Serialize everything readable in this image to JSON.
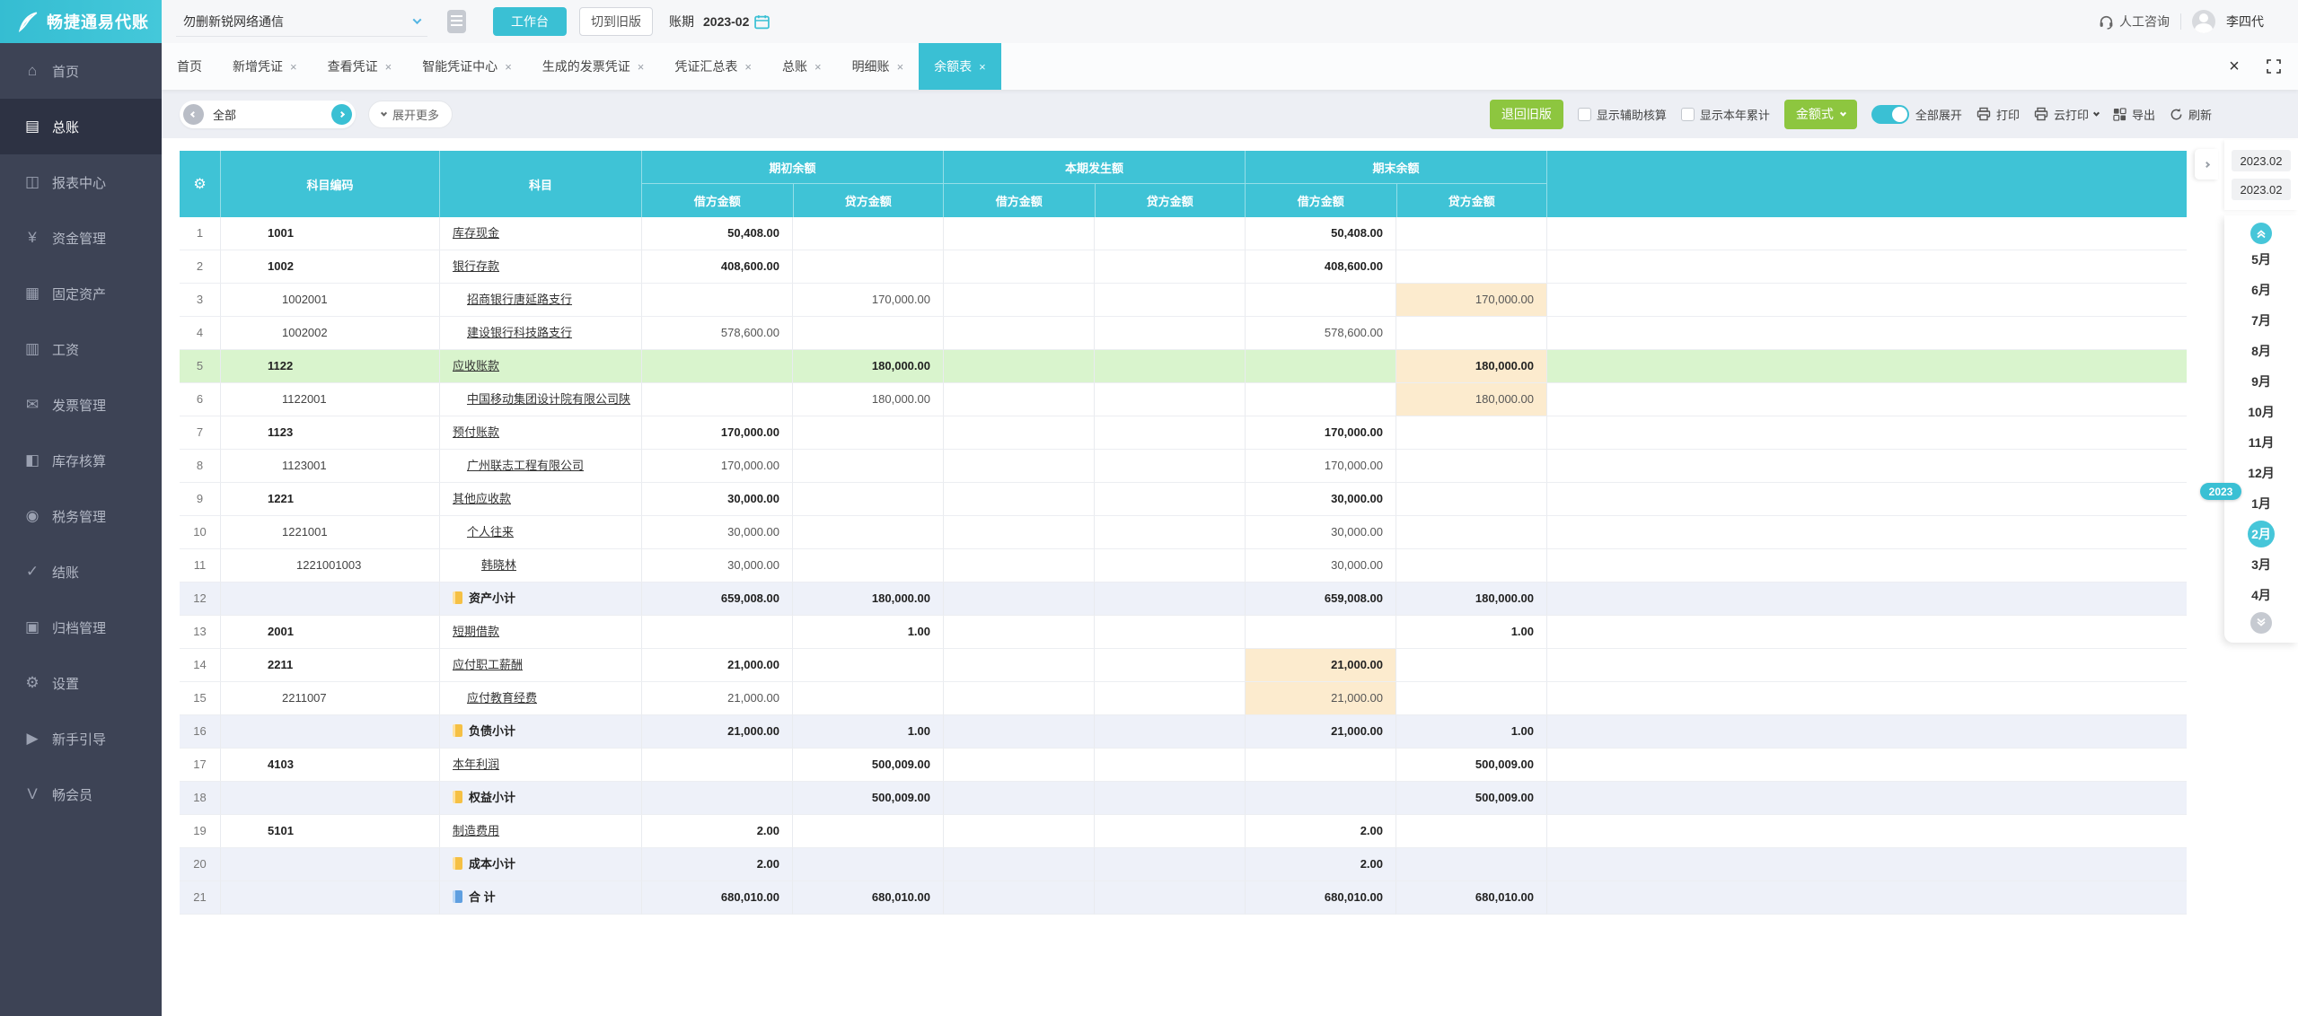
{
  "app": {
    "logo_text": "畅捷通易代账",
    "company": "勿删新锐网络通信",
    "workbench_button": "工作台",
    "switch_old_button": "切到旧版",
    "period_label": "账期",
    "period_value": "2023-02",
    "support_label": "人工咨询",
    "user_name": "李四代"
  },
  "sidebar": {
    "items": [
      {
        "label": "首页",
        "icon": "home-icon",
        "active": false
      },
      {
        "label": "总账",
        "icon": "ledger-icon",
        "active": true
      },
      {
        "label": "报表中心",
        "icon": "report-icon",
        "active": false
      },
      {
        "label": "资金管理",
        "icon": "funds-icon",
        "active": false
      },
      {
        "label": "固定资产",
        "icon": "fixed-asset-icon",
        "active": false
      },
      {
        "label": "工资",
        "icon": "salary-icon",
        "active": false
      },
      {
        "label": "发票管理",
        "icon": "invoice-icon",
        "active": false
      },
      {
        "label": "库存核算",
        "icon": "inventory-icon",
        "active": false
      },
      {
        "label": "税务管理",
        "icon": "tax-icon",
        "active": false
      },
      {
        "label": "结账",
        "icon": "closing-icon",
        "active": false
      },
      {
        "label": "归档管理",
        "icon": "archive-icon",
        "active": false
      },
      {
        "label": "设置",
        "icon": "settings-icon",
        "active": false
      },
      {
        "label": "新手引导",
        "icon": "guide-icon",
        "active": false
      },
      {
        "label": "畅会员",
        "icon": "member-icon",
        "active": false
      }
    ]
  },
  "tabs": {
    "items": [
      {
        "label": "首页",
        "closable": false,
        "active": false
      },
      {
        "label": "新增凭证",
        "closable": true,
        "active": false
      },
      {
        "label": "查看凭证",
        "closable": true,
        "active": false
      },
      {
        "label": "智能凭证中心",
        "closable": true,
        "active": false
      },
      {
        "label": "生成的发票凭证",
        "closable": true,
        "active": false
      },
      {
        "label": "凭证汇总表",
        "closable": true,
        "active": false
      },
      {
        "label": "总账",
        "closable": true,
        "active": false
      },
      {
        "label": "明细账",
        "closable": true,
        "active": false
      },
      {
        "label": "余额表",
        "closable": true,
        "active": true
      }
    ]
  },
  "toolbar": {
    "scope_value": "全部",
    "expand_more_label": "展开更多",
    "back_old_version_label": "退回旧版",
    "checkbox_aux_label": "显示辅助核算",
    "checkbox_ytd_label": "显示本年累计",
    "amount_style_label": "金额式",
    "expand_all_label": "全部展开",
    "print_label": "打印",
    "cloud_print_label": "云打印",
    "export_label": "导出",
    "refresh_label": "刷新"
  },
  "table": {
    "headers": {
      "code": "科目编码",
      "subject": "科目",
      "debit": "借方金额",
      "credit": "贷方金额",
      "groups": [
        {
          "label": "期初余额"
        },
        {
          "label": "本期发生额"
        },
        {
          "label": "期末余额"
        }
      ]
    },
    "rows": [
      {
        "num": 1,
        "code": "1001",
        "name": "库存现金",
        "level": 0,
        "bold": true,
        "expand": false,
        "underline": true,
        "icon": "",
        "bg": "",
        "hl": [],
        "od": "50,408.00",
        "oc": "",
        "cd": "",
        "cc": "",
        "ed": "50,408.00",
        "ec": ""
      },
      {
        "num": 2,
        "code": "1002",
        "name": "银行存款",
        "level": 0,
        "bold": true,
        "expand": true,
        "underline": true,
        "icon": "",
        "bg": "",
        "hl": [],
        "od": "408,600.00",
        "oc": "",
        "cd": "",
        "cc": "",
        "ed": "408,600.00",
        "ec": ""
      },
      {
        "num": 3,
        "code": "1002001",
        "name": "招商银行唐延路支行",
        "level": 1,
        "bold": false,
        "expand": false,
        "underline": true,
        "icon": "",
        "bg": "",
        "hl": [
          "ec"
        ],
        "od": "",
        "oc": "170,000.00",
        "cd": "",
        "cc": "",
        "ed": "",
        "ec": "170,000.00"
      },
      {
        "num": 4,
        "code": "1002002",
        "name": "建设银行科技路支行",
        "level": 1,
        "bold": false,
        "expand": false,
        "underline": true,
        "icon": "",
        "bg": "",
        "hl": [],
        "od": "578,600.00",
        "oc": "",
        "cd": "",
        "cc": "",
        "ed": "578,600.00",
        "ec": ""
      },
      {
        "num": 5,
        "code": "1122",
        "name": "应收账款",
        "level": 0,
        "bold": true,
        "expand": true,
        "underline": true,
        "icon": "",
        "bg": "green",
        "hl": [
          "ec"
        ],
        "od": "",
        "oc": "180,000.00",
        "cd": "",
        "cc": "",
        "ed": "",
        "ec": "180,000.00"
      },
      {
        "num": 6,
        "code": "1122001",
        "name": "中国移动集团设计院有限公司陕",
        "level": 1,
        "bold": false,
        "expand": false,
        "underline": true,
        "icon": "",
        "bg": "",
        "hl": [
          "ec"
        ],
        "od": "",
        "oc": "180,000.00",
        "cd": "",
        "cc": "",
        "ed": "",
        "ec": "180,000.00"
      },
      {
        "num": 7,
        "code": "1123",
        "name": "预付账款",
        "level": 0,
        "bold": true,
        "expand": true,
        "underline": true,
        "icon": "",
        "bg": "",
        "hl": [],
        "od": "170,000.00",
        "oc": "",
        "cd": "",
        "cc": "",
        "ed": "170,000.00",
        "ec": ""
      },
      {
        "num": 8,
        "code": "1123001",
        "name": "广州联志工程有限公司",
        "level": 1,
        "bold": false,
        "expand": false,
        "underline": true,
        "icon": "",
        "bg": "",
        "hl": [],
        "od": "170,000.00",
        "oc": "",
        "cd": "",
        "cc": "",
        "ed": "170,000.00",
        "ec": ""
      },
      {
        "num": 9,
        "code": "1221",
        "name": "其他应收款",
        "level": 0,
        "bold": true,
        "expand": true,
        "underline": true,
        "icon": "",
        "bg": "",
        "hl": [],
        "od": "30,000.00",
        "oc": "",
        "cd": "",
        "cc": "",
        "ed": "30,000.00",
        "ec": ""
      },
      {
        "num": 10,
        "code": "1221001",
        "name": "个人往来",
        "level": 1,
        "bold": false,
        "expand": true,
        "underline": true,
        "icon": "",
        "bg": "",
        "hl": [],
        "od": "30,000.00",
        "oc": "",
        "cd": "",
        "cc": "",
        "ed": "30,000.00",
        "ec": ""
      },
      {
        "num": 11,
        "code": "1221001003",
        "name": "韩晓林",
        "level": 2,
        "bold": false,
        "expand": false,
        "underline": true,
        "icon": "",
        "bg": "",
        "hl": [],
        "od": "30,000.00",
        "oc": "",
        "cd": "",
        "cc": "",
        "ed": "30,000.00",
        "ec": ""
      },
      {
        "num": 12,
        "code": "",
        "name": "资产小计",
        "level": 0,
        "bold": true,
        "expand": false,
        "underline": false,
        "icon": "yellow",
        "bg": "lav",
        "hl": [],
        "od": "659,008.00",
        "oc": "180,000.00",
        "cd": "",
        "cc": "",
        "ed": "659,008.00",
        "ec": "180,000.00"
      },
      {
        "num": 13,
        "code": "2001",
        "name": "短期借款",
        "level": 0,
        "bold": true,
        "expand": false,
        "underline": true,
        "icon": "",
        "bg": "",
        "hl": [],
        "od": "",
        "oc": "1.00",
        "cd": "",
        "cc": "",
        "ed": "",
        "ec": "1.00"
      },
      {
        "num": 14,
        "code": "2211",
        "name": "应付职工薪酬",
        "level": 0,
        "bold": true,
        "expand": true,
        "underline": true,
        "icon": "",
        "bg": "",
        "hl": [
          "ed"
        ],
        "od": "21,000.00",
        "oc": "",
        "cd": "",
        "cc": "",
        "ed": "21,000.00",
        "ec": ""
      },
      {
        "num": 15,
        "code": "2211007",
        "name": "应付教育经费",
        "level": 1,
        "bold": false,
        "expand": false,
        "underline": true,
        "icon": "",
        "bg": "",
        "hl": [
          "ed"
        ],
        "od": "21,000.00",
        "oc": "",
        "cd": "",
        "cc": "",
        "ed": "21,000.00",
        "ec": ""
      },
      {
        "num": 16,
        "code": "",
        "name": "负债小计",
        "level": 0,
        "bold": true,
        "expand": false,
        "underline": false,
        "icon": "yellow",
        "bg": "lav",
        "hl": [],
        "od": "21,000.00",
        "oc": "1.00",
        "cd": "",
        "cc": "",
        "ed": "21,000.00",
        "ec": "1.00"
      },
      {
        "num": 17,
        "code": "4103",
        "name": "本年利润",
        "level": 0,
        "bold": true,
        "expand": false,
        "underline": true,
        "icon": "",
        "bg": "",
        "hl": [],
        "od": "",
        "oc": "500,009.00",
        "cd": "",
        "cc": "",
        "ed": "",
        "ec": "500,009.00"
      },
      {
        "num": 18,
        "code": "",
        "name": "权益小计",
        "level": 0,
        "bold": true,
        "expand": false,
        "underline": false,
        "icon": "yellow",
        "bg": "lav",
        "hl": [],
        "od": "",
        "oc": "500,009.00",
        "cd": "",
        "cc": "",
        "ed": "",
        "ec": "500,009.00"
      },
      {
        "num": 19,
        "code": "5101",
        "name": "制造费用",
        "level": 0,
        "bold": true,
        "expand": false,
        "underline": true,
        "icon": "",
        "bg": "",
        "hl": [],
        "od": "2.00",
        "oc": "",
        "cd": "",
        "cc": "",
        "ed": "2.00",
        "ec": ""
      },
      {
        "num": 20,
        "code": "",
        "name": "成本小计",
        "level": 0,
        "bold": true,
        "expand": false,
        "underline": false,
        "icon": "yellow",
        "bg": "lav",
        "hl": [],
        "od": "2.00",
        "oc": "",
        "cd": "",
        "cc": "",
        "ed": "2.00",
        "ec": ""
      },
      {
        "num": 21,
        "code": "",
        "name": "合 计",
        "level": 0,
        "bold": true,
        "expand": false,
        "underline": false,
        "icon": "blue",
        "bg": "lav",
        "hl": [],
        "od": "680,010.00",
        "oc": "680,010.00",
        "cd": "",
        "cc": "",
        "ed": "680,010.00",
        "ec": "680,010.00"
      }
    ]
  },
  "period_panel": {
    "date_from": "2023.02",
    "date_to": "2023.02",
    "year_badge": "2023",
    "year_badge_before": "1月",
    "months": [
      "5月",
      "6月",
      "7月",
      "8月",
      "9月",
      "10月",
      "11月",
      "12月",
      "1月",
      "2月",
      "3月",
      "4月"
    ],
    "selected_month": "2月"
  },
  "colors": {
    "teal": "#3ac0d4",
    "green_button": "#8dc63f",
    "row_highlight_orange": "#fcebce",
    "row_selected_green": "#d9f4cd",
    "subtotal_lavender": "#eef1f9",
    "sidebar_bg": "#3d4355"
  }
}
